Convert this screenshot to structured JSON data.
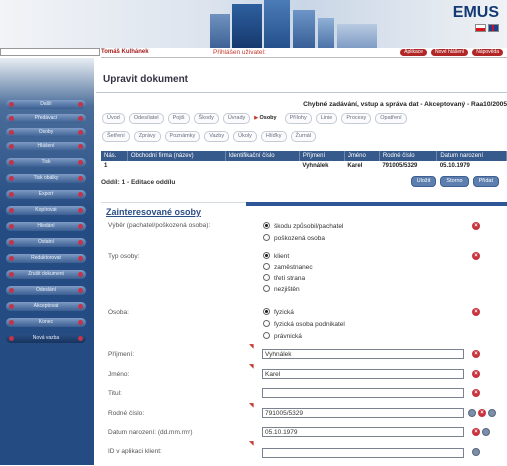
{
  "header": {
    "logo": "EMUS",
    "user_label": "Přihlášen uživatel:",
    "user_name": "Tomáš Kulhánek",
    "top_links": [
      "Aplikace",
      "Nové hlášení",
      "Nápověda"
    ]
  },
  "sidebar": {
    "items": [
      "Další",
      "Předávací",
      "Osoby",
      "Hlášení",
      "Tisk",
      "Tisk obálky",
      "Export",
      "Kopírovat",
      "Hledání",
      "Ostatní",
      "Redaktorovat",
      "Zrušit dokument",
      "Odeslání",
      "Akceptovat",
      "Konec",
      "Nová vazba"
    ],
    "selected_index": 15
  },
  "page": {
    "title": "Upravit dokument",
    "subtitle": "Chybné zadávání, vstup a správa dat - Akceptovaný - Raa10/2005",
    "tabs_row1": [
      "Úvod",
      "Odesílatel",
      "Pojiš",
      "Škody",
      "Úvrady",
      "Osoby",
      "Přílohy",
      "Linie",
      "Procesy",
      "Opatření"
    ],
    "tabs_row1_active": 5,
    "tabs_row2": [
      "Šetření",
      "Zprávy",
      "Poznámky",
      "Vazby",
      "Úkoly",
      "Hlíďky",
      "Žurnál"
    ]
  },
  "table": {
    "headers": [
      "Nás.",
      "Obchodní firma (název)",
      "Identifikační číslo",
      "Příjmení",
      "Jméno",
      "Rodné číslo",
      "Datum narození"
    ],
    "rows": [
      [
        "1",
        "",
        "",
        "Vyhnálek",
        "Karel",
        "791005/5329",
        "05.10.1979"
      ]
    ]
  },
  "section": {
    "line": "Oddíl: 1 - Editace oddílu",
    "buttons": [
      "Uložit",
      "Storno",
      "Přidat"
    ],
    "title": "Zainteresované osoby"
  },
  "form": {
    "vyber_label": "Výběr (pachatel/poškozená osoba):",
    "vyber_options": [
      "škodu způsobil/pachatel",
      "poškozená osoba"
    ],
    "typ_label": "Typ osoby:",
    "typ_options": [
      "klient",
      "zaměstnanec",
      "třetí strana",
      "nezjištěn"
    ],
    "osoba_label": "Osoba:",
    "osoba_options": [
      "fyzická",
      "fyzická osoba podnikatel",
      "právnická"
    ],
    "prijmeni_label": "Příjmení:",
    "prijmeni_value": "Vyhnálek",
    "jmeno_label": "Jméno:",
    "jmeno_value": "Karel",
    "titul_label": "Titul:",
    "titul_value": "",
    "rodne_label": "Rodné číslo:",
    "rodne_value": "791005/5329",
    "datum_label": "Datum narození: (dd.mm.rrrr)",
    "datum_value": "05.10.1979",
    "idv_label": "ID v aplikaci klient:",
    "idv_value": ""
  }
}
